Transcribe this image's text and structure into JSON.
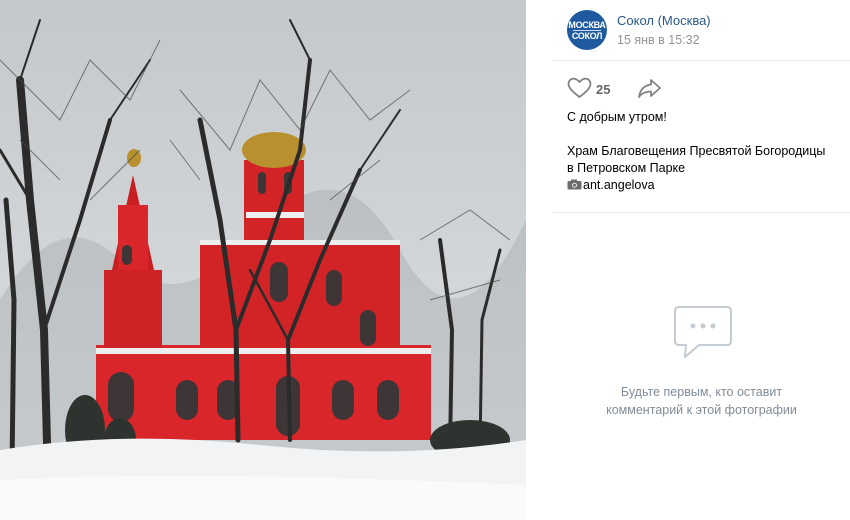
{
  "photo": {
    "alt": "Church photo"
  },
  "post": {
    "author": "Сокол (Москва)",
    "date": "15 янв в 15:32",
    "avatar": {
      "line1": "МОСКВА",
      "line2": "СОКОЛ",
      "color": "#1f5aa0"
    },
    "likes": "25",
    "greeting": "С добрым утром!",
    "caption_line1": "Храм Благовещения Пресвятой Богородицы",
    "caption_line2": "в Петровском Парке",
    "author_tag": "ant.angelova"
  },
  "comments": {
    "empty_line1": "Будьте первым, кто оставит",
    "empty_line2": "комментарий к этой фотографии"
  },
  "colors": {
    "link": "#2a5885",
    "muted": "#939393",
    "church": "#d8262a"
  }
}
